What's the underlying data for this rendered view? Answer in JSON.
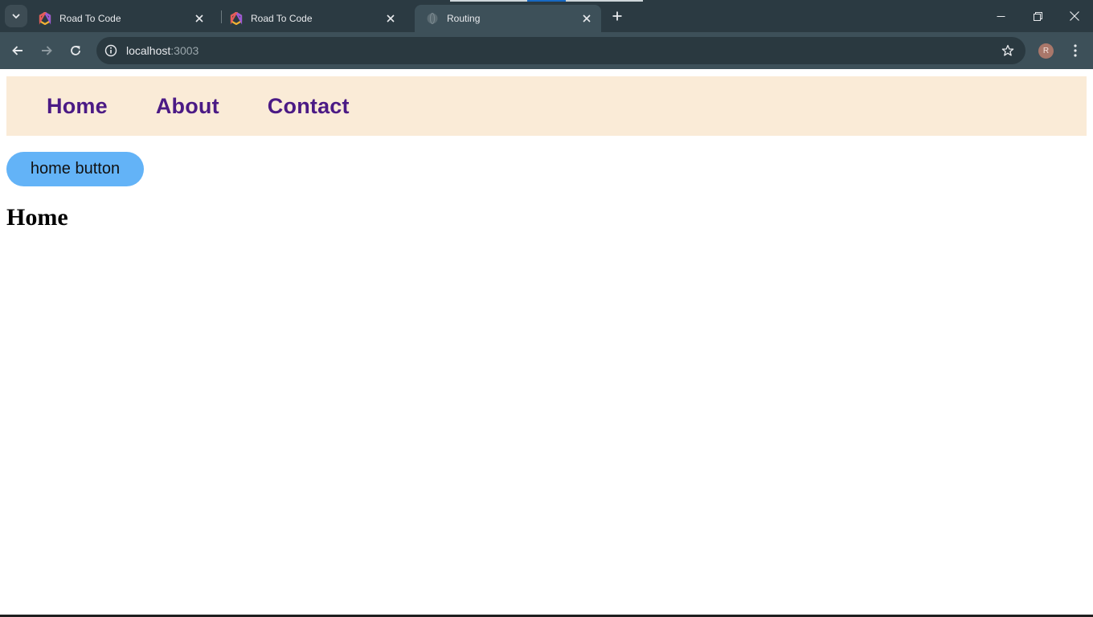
{
  "browser": {
    "tabs": [
      {
        "title": "Road To Code",
        "favicon": "road-to-code-favicon",
        "active": false
      },
      {
        "title": "Road To Code",
        "favicon": "road-to-code-favicon",
        "active": false
      },
      {
        "title": "Routing",
        "favicon": "globe-favicon",
        "active": true
      }
    ],
    "address": {
      "host": "localhost",
      "port": ":3003"
    },
    "profile_initial": "R"
  },
  "page": {
    "nav": {
      "home": "Home",
      "about": "About",
      "contact": "Contact"
    },
    "home_button_label": "home button",
    "heading": "Home"
  },
  "colors": {
    "navbar_bg": "#faebd7",
    "nav_link": "#4b1a85",
    "button_bg": "#63b3f7",
    "chrome_dark": "#2b3a42",
    "chrome_toolbar": "#3d5059"
  }
}
